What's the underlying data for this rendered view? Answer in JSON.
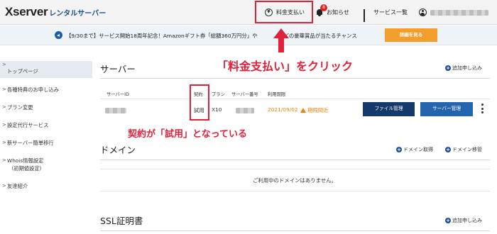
{
  "header": {
    "logo_main": "Xserver",
    "logo_sub": "レンタルサーバー",
    "nav": {
      "payment": "料金支払い",
      "notice": "お知らせ",
      "notice_badge": "8",
      "services": "サービス一覧"
    }
  },
  "campaign": {
    "text": "【9/30まで】サービス開始18周年記念！Amazonギフト券「総額360万円分」や　　　　などの豪華賞品が当たるチャンス",
    "button_label": "詳細を見る"
  },
  "sidebar": {
    "items": [
      {
        "label": "トップページ"
      },
      {
        "label": "各種特典のお申し込み"
      },
      {
        "label": "プラン変更"
      },
      {
        "label": "設定代行サービス"
      },
      {
        "label": "新サーバー簡単移行"
      },
      {
        "label": "Whois情報設定",
        "sub": "（初期値設定）"
      },
      {
        "label": "友達紹介"
      }
    ]
  },
  "server": {
    "title": "サーバー",
    "add_label": "追加申し込み",
    "columns": [
      "サーバーID",
      "契約",
      "プラン",
      "サーバー番号",
      "利用期限"
    ],
    "row": {
      "contract": "試用",
      "plan": "X10",
      "expiry_date": "2021/09/02",
      "expiry_status": "期限間近",
      "file_button": "ファイル管理",
      "server_button": "サーバー管理"
    }
  },
  "domain": {
    "title": "ドメイン",
    "acquire_label": "ドメイン取得",
    "transfer_label": "ドメイン移管",
    "empty_message": "ご利用中のドメインはありません。"
  },
  "ssl": {
    "title": "SSL証明書",
    "add_label": "追加申し込み"
  },
  "annotations": {
    "payment_note": "「料金支払い」をクリック",
    "contract_note": "契約が「試用」となっている"
  },
  "colors": {
    "highlight": "#e0213a",
    "primary_button": "#15396a",
    "secondary_button": "#2463ad",
    "campaign_button": "#f39d2a",
    "warning": "#e8860e"
  }
}
